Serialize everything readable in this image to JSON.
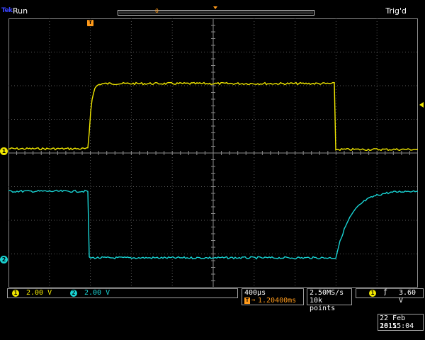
{
  "status": {
    "brand": "Tek",
    "acquisition_state": "Run",
    "trigger_state": "Trig'd",
    "trigger_position_marker": "0"
  },
  "channels": [
    {
      "id": "1",
      "label": "1",
      "scale": "2.00 V",
      "color": "#f2e800"
    },
    {
      "id": "2",
      "label": "2",
      "scale": "2.00 V",
      "color": "#19d4d4"
    }
  ],
  "timebase": {
    "time_per_div": "400µs",
    "trigger_delay": "1.20400ms",
    "trigger_delay_icon": "T"
  },
  "acquisition": {
    "sample_rate": "2.50MS/s",
    "record_length": "10k points"
  },
  "trigger": {
    "source": "1",
    "slope_icon": "rising-edge-icon",
    "slope_glyph": "ƒ",
    "level": "3.60 V"
  },
  "datetime": {
    "date": "22 Feb  2011",
    "time": "16:55:04"
  },
  "colors": {
    "ch1": "#f2e800",
    "ch2": "#19d4d4",
    "trigger_marker": "#ff9a1a",
    "background": "#000000"
  }
}
